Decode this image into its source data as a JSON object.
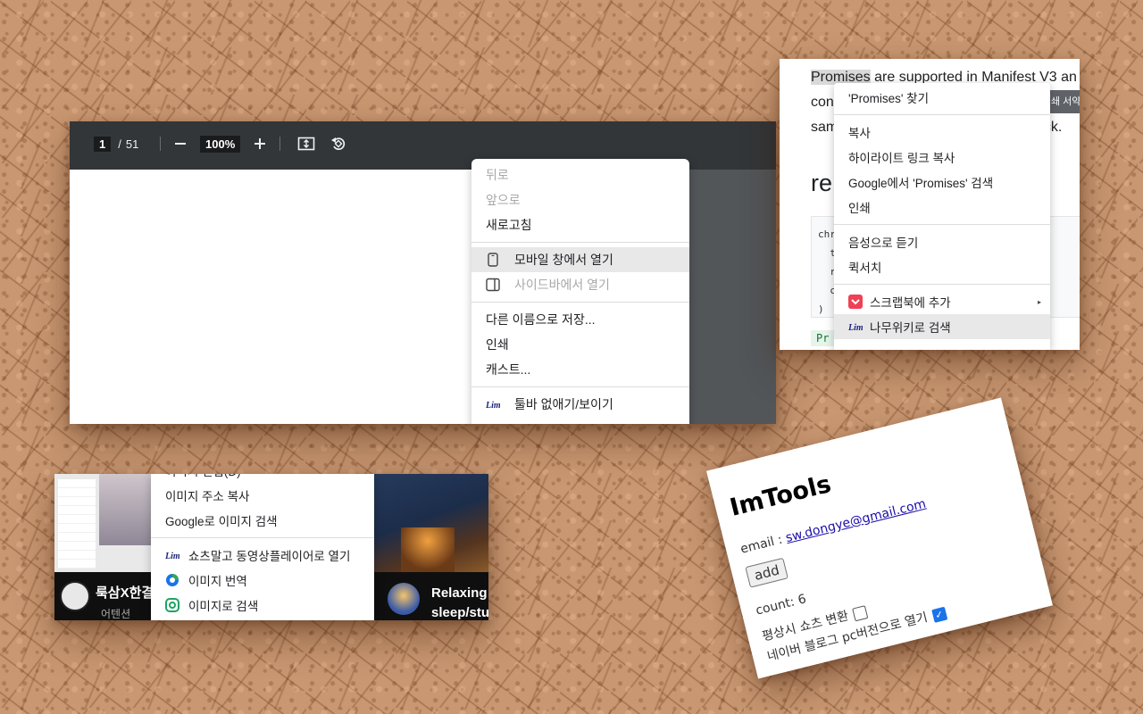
{
  "pdf_viewer": {
    "page_current": "1",
    "page_sep": "/",
    "page_total": "51",
    "zoom": "100%",
    "context_menu": {
      "back": "뒤로",
      "forward": "앞으로",
      "reload": "새로고침",
      "open_mobile": "모바일 창에서 열기",
      "open_sidebar": "사이드바에서 열기",
      "save_as": "다른 이름으로 저장...",
      "print": "인쇄",
      "cast": "캐스트...",
      "toggle_toolbar": "툴바 없애기/보이기"
    }
  },
  "promises_page": {
    "line1_sel": "Promises",
    "line1_rest": " are supported in Manifest V3 an",
    "line2": "con",
    "line3_start": "sam",
    "line3_end": "ack.",
    "heading_start": "re",
    "badge": "쇄 서약",
    "code_lines": [
      "chr",
      "  t",
      "  r",
      "  c",
      ")"
    ],
    "after_code": "Pr",
    "context_menu": {
      "find": "'Promises' 찾기",
      "copy": "복사",
      "copy_highlight": "하이라이트 링크 복사",
      "google_search": "Google에서 'Promises' 검색",
      "print": "인쇄",
      "listen": "음성으로 듣기",
      "quick_search": "퀵서치",
      "scrapbook": "스크랩북에 추가",
      "namuwiki": "나무위키로 검색"
    }
  },
  "thumbnails": {
    "menu_top_partial": "이미지 편집(D)",
    "copy_image_address": "이미지 주소 복사",
    "google_image_search": "Google로 이미지 검색",
    "open_player": "쇼츠말고 동영상플레이어로 열기",
    "translate_image": "이미지 번역",
    "search_by_image": "이미지로 검색",
    "video1_title": "룩삼X한결",
    "video1_channel": "어텐션",
    "video2_title_l1": "Relaxing",
    "video2_title_l2": "sleep/stu"
  },
  "imtools": {
    "title": "ImTools",
    "email_label": "email : ",
    "email": "sw.dongye@gmail.com",
    "add": "add",
    "count": "count: 6",
    "shorts_convert": "평상시 쇼츠 변환",
    "naver_pc": "네이버 블로그 pc버전으로 열기",
    "shorts_checked": false,
    "naver_checked": true
  }
}
